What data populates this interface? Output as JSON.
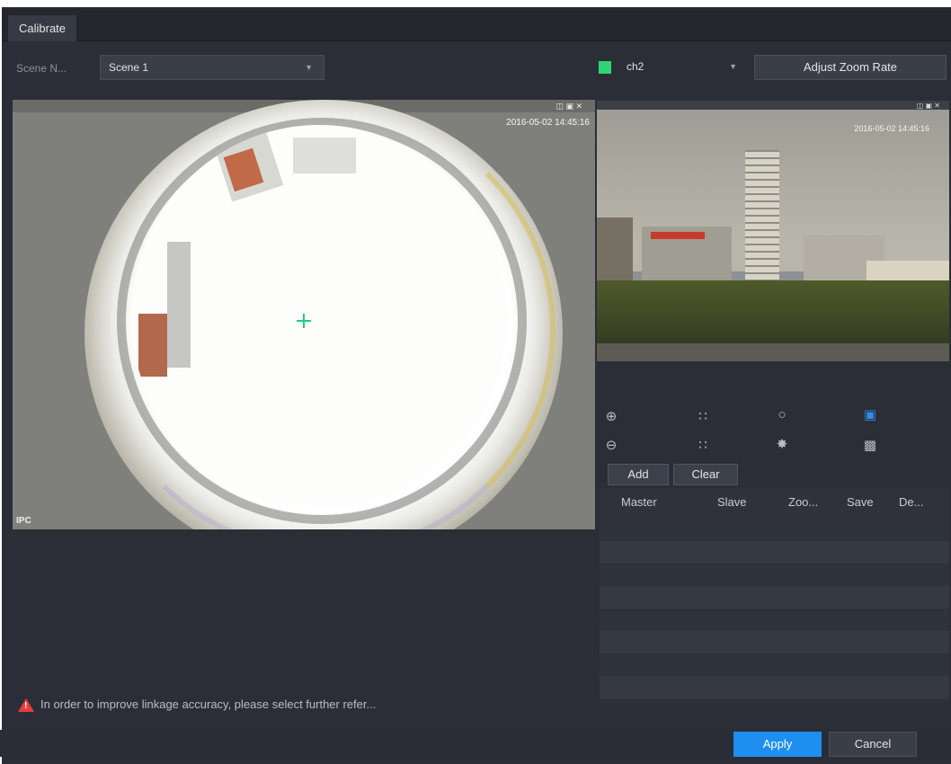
{
  "window": {
    "title": "Calibrate"
  },
  "scene": {
    "label": "Scene N...",
    "selected": "Scene 1"
  },
  "channel": {
    "selected": "ch2",
    "swatch_color": "#2ed573"
  },
  "buttons": {
    "adjust_zoom_rate": "Adjust Zoom Rate",
    "add": "Add",
    "clear": "Clear",
    "apply": "Apply",
    "cancel": "Cancel"
  },
  "fisheye": {
    "osd_time": "2016-05-02 14:45:16",
    "channel_label": "IPC"
  },
  "ptz_view": {
    "osd_time": "2016-05-02 14:45:16"
  },
  "ptz_controls": [
    "zoom-in-icon",
    "focus-near-icon",
    "iris-open-icon",
    "zoom-frame-icon",
    "zoom-out-icon",
    "focus-far-icon",
    "iris-close-icon",
    "lock-icon"
  ],
  "table": {
    "columns": [
      "Master",
      "Slave",
      "Zoo...",
      "Save",
      "De..."
    ],
    "rows": []
  },
  "warning": "In order to improve linkage accuracy, please select further refer...",
  "colors": {
    "accent": "#1e8ff0",
    "warning": "#e83d3d",
    "background": "#2b2e36"
  }
}
